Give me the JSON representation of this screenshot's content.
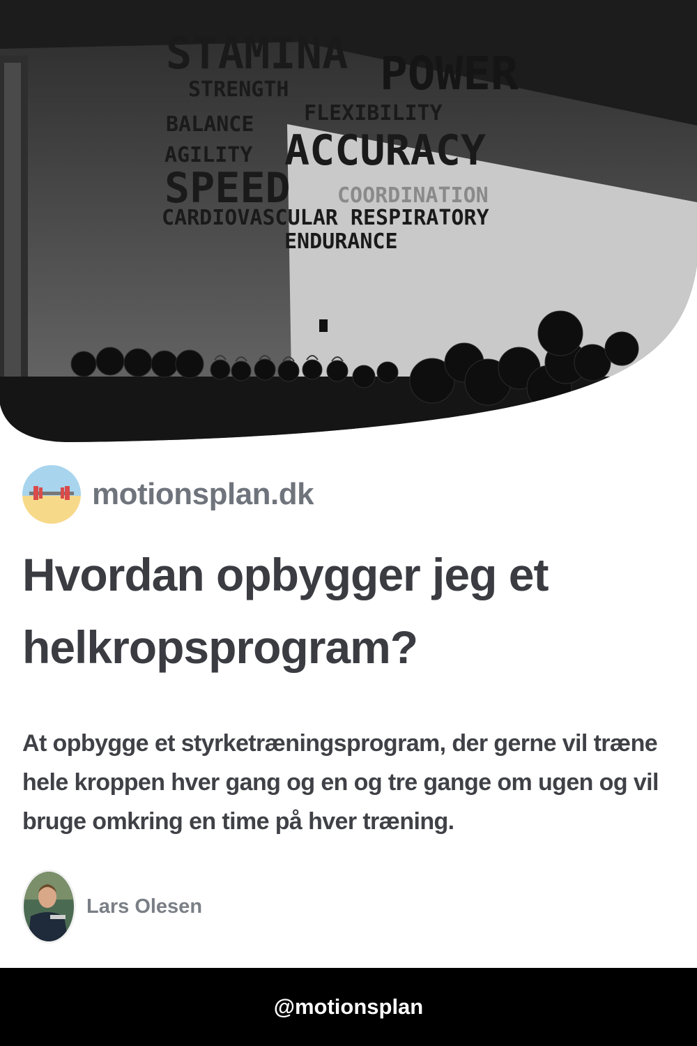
{
  "hero": {
    "wall_words": {
      "stamina": "STAMINA",
      "power": "POWER",
      "strength": "STRENGTH",
      "flexibility": "FLEXIBILITY",
      "balance": "BALANCE",
      "agility": "AGILITY",
      "accuracy": "ACCURACY",
      "speed": "SPEED",
      "coordination": "COORDINATION",
      "cardio": "CARDIOVASCULAR RESPIRATORY",
      "endurance": "ENDURANCE"
    }
  },
  "site": {
    "name": "motionsplan.dk",
    "logo_icon": "barbell-icon"
  },
  "article": {
    "title": "Hvordan opbygger jeg et helkropsprogram?",
    "description": "At opbygge et styrketræningsprogram, der gerne vil træne hele kroppen hver gang og en og tre gange om ugen og vil bruge omkring en time på hver træning."
  },
  "author": {
    "name": "Lars Olesen"
  },
  "footer": {
    "handle": "@motionsplan"
  }
}
